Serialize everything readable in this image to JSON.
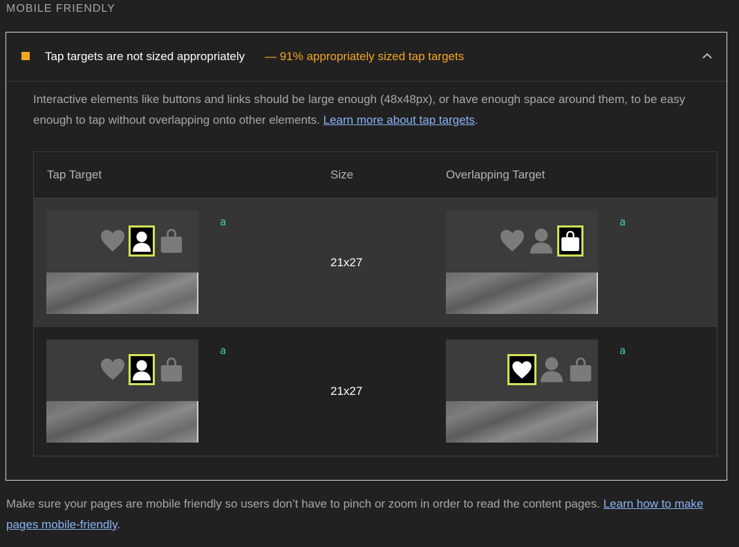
{
  "section": {
    "title": "MOBILE FRIENDLY"
  },
  "audit": {
    "status_color": "#f5a623",
    "title": "Tap targets are not sized appropriately",
    "display_value": "— 91% appropriately sized tap targets",
    "description": "Interactive elements like buttons and links should be large enough (48x48px), or have enough space around them, to be easy enough to tap without overlapping onto other elements. ",
    "learn_more": "Learn more about tap targets",
    "description_end": ".",
    "expanded_icon": "chevron-up-icon"
  },
  "table": {
    "headers": {
      "tap_target": "Tap Target",
      "size": "Size",
      "overlapping": "Overlapping Target"
    },
    "rows": [
      {
        "tap_target_label": "a",
        "size": "21x27",
        "overlapping_label": "a",
        "target_icon": "person-icon",
        "overlap_icon": "shopping-bag-icon"
      },
      {
        "tap_target_label": "a",
        "size": "21x27",
        "overlapping_label": "a",
        "target_icon": "person-icon",
        "overlap_icon": "heart-icon"
      }
    ]
  },
  "footer": {
    "text": "Make sure your pages are mobile friendly so users don’t have to pinch or zoom in order to read the content pages. ",
    "link": "Learn how to make pages mobile-friendly",
    "end": "."
  }
}
